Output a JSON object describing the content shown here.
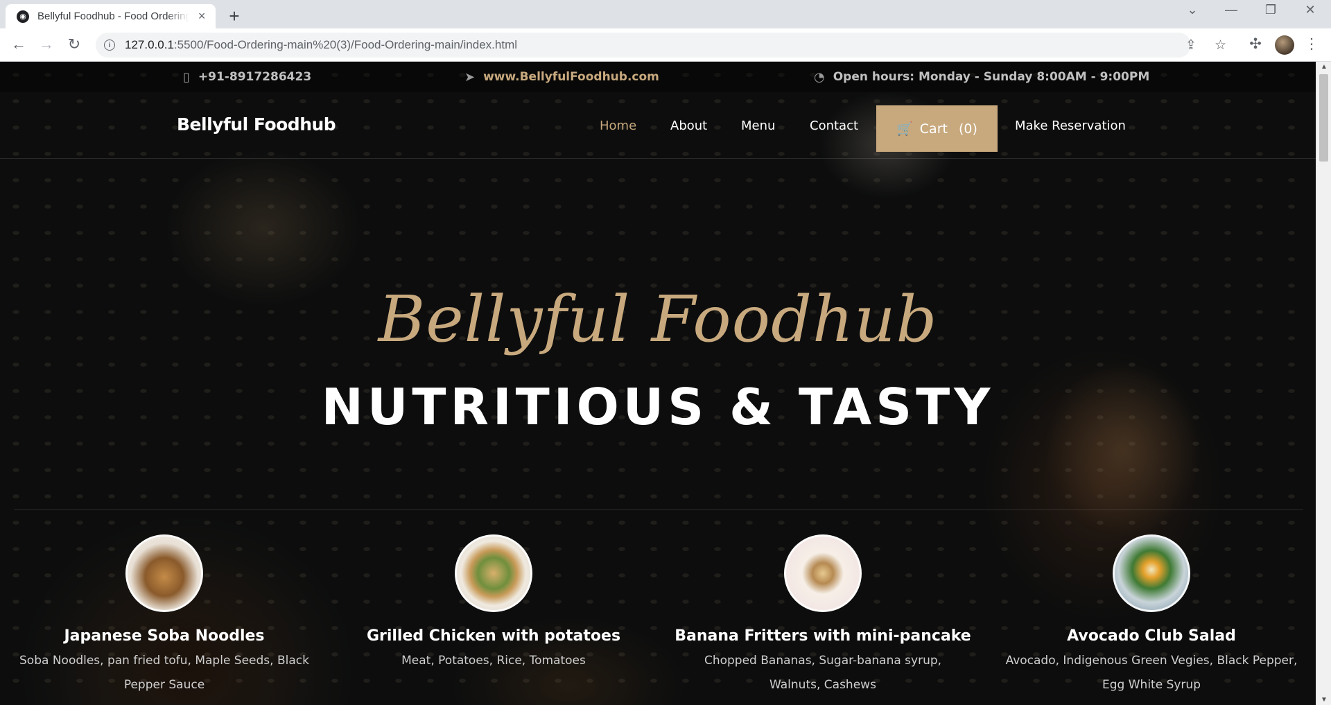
{
  "browser": {
    "tab_title": "Bellyful Foodhub - Food Ordering",
    "favicon": "app-favicon-icon",
    "url_host": "127.0.0.1",
    "url_path": ":5500/Food-Ordering-main%20(3)/Food-Ordering-main/index.html",
    "new_tab_label": "+",
    "icons": {
      "back": "←",
      "forward": "→",
      "reload": "↻",
      "info": "i",
      "share": "⇪",
      "star": "☆",
      "extensions": "✣",
      "menu": "⋮",
      "tab_search": "⌄",
      "minimize": "—",
      "restore": "❐",
      "close": "✕",
      "tab_close": "×"
    }
  },
  "topbar": {
    "phone": "+91-8917286423",
    "website": "www.BellyfulFoodhub.com",
    "hours": "Open hours: Monday - Sunday 8:00AM - 9:00PM",
    "phone_icon": "▯",
    "website_icon": "➤",
    "hours_icon": "◔"
  },
  "navbar": {
    "brand": "Bellyful Foodhub",
    "links": {
      "home": "Home",
      "about": "About",
      "menu": "Menu",
      "contact": "Contact",
      "reservation": "Make Reservation"
    },
    "cart_label": "Cart",
    "cart_count": "(0)",
    "cart_icon": "🛒"
  },
  "hero": {
    "script_title": "Bellyful Foodhub",
    "title": "NUTRITIOUS & TASTY"
  },
  "features": [
    {
      "title": "Japanese Soba Noodles",
      "desc": "Soba Noodles, pan fried tofu, Maple Seeds, Black Pepper Sauce"
    },
    {
      "title": "Grilled Chicken with potatoes",
      "desc": "Meat, Potatoes, Rice, Tomatoes"
    },
    {
      "title": "Banana Fritters with mini-pancake",
      "desc": "Chopped Bananas, Sugar-banana syrup, Walnuts, Cashews"
    },
    {
      "title": "Avocado Club Salad",
      "desc": "Avocado, Indigenous Green Vegies, Black Pepper, Egg White Syrup"
    }
  ],
  "colors": {
    "accent": "#c8a97e",
    "background": "#141515",
    "text": "#ffffff"
  }
}
